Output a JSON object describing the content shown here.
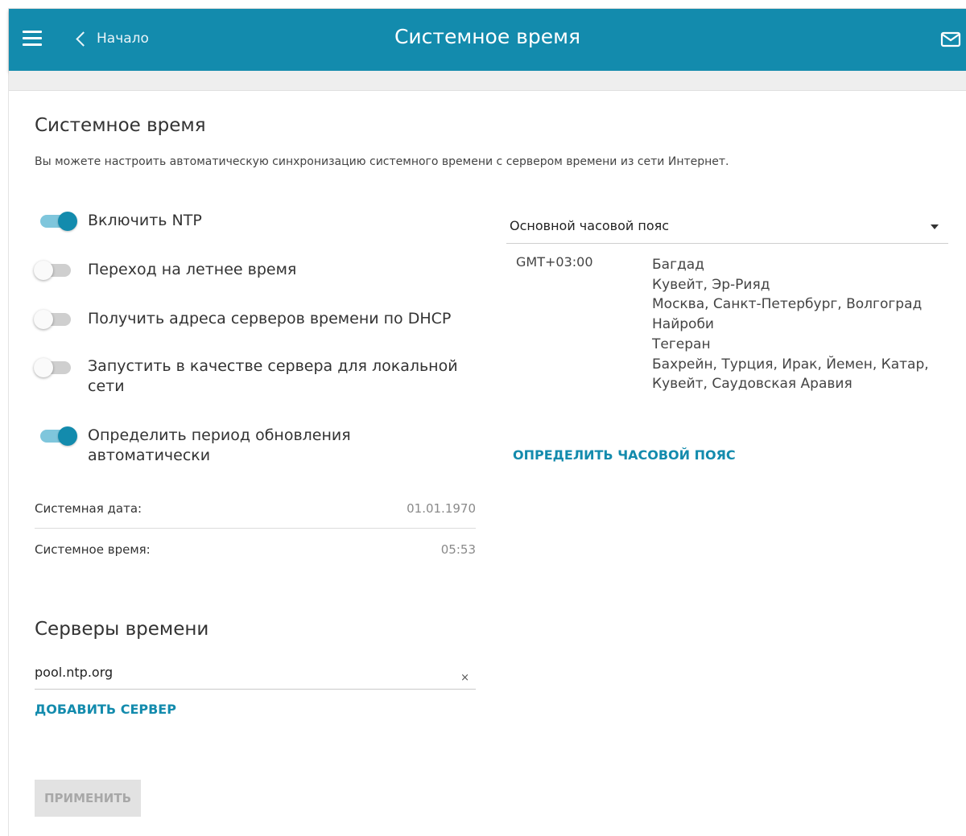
{
  "header": {
    "back_label": "Начало",
    "title": "Системное время",
    "menu_icon": "hamburger-menu-icon",
    "mail_icon": "mail-icon"
  },
  "colors": {
    "brand": "#138bad",
    "toggle_track_on": "#7fc6dc",
    "toggle_off": "#cfcfcf"
  },
  "main": {
    "heading": "Системное время",
    "description": "Вы можете настроить автоматическую синхронизацию системного времени с сервером времени из сети Интернет.",
    "toggles": {
      "ntp": {
        "label": "Включить NTP",
        "on": true
      },
      "dst": {
        "label": "Переход на летнее время",
        "on": false
      },
      "dhcp": {
        "label": "Получить адреса серверов времени по DHCP",
        "on": false
      },
      "local_server": {
        "label": "Запустить в качестве сервера для локальной сети",
        "on": false
      },
      "auto_period": {
        "label": "Определить период обновления автоматически",
        "on": true
      }
    },
    "system_date": {
      "label": "Системная дата:",
      "value": "01.01.1970"
    },
    "system_time": {
      "label": "Системное время:",
      "value": "05:53"
    }
  },
  "timezone": {
    "select_label": "Основной часовой пояс",
    "offset": "GMT+03:00",
    "cities": [
      "Багдад",
      "Кувейт, Эр-Рияд",
      "Москва, Санкт-Петербург, Волгоград",
      "Найроби",
      "Тегеран",
      "Бахрейн, Турция, Ирак, Йемен, Катар,",
      "Кувейт, Саудовская Аравия"
    ],
    "detect_button": "ОПРЕДЕЛИТЬ ЧАСОВОЙ ПОЯС"
  },
  "servers": {
    "heading": "Серверы времени",
    "items": [
      "pool.ntp.org"
    ],
    "clear_symbol": "×",
    "add_button": "ДОБАВИТЬ СЕРВЕР"
  },
  "actions": {
    "apply_label": "ПРИМЕНИТЬ"
  }
}
